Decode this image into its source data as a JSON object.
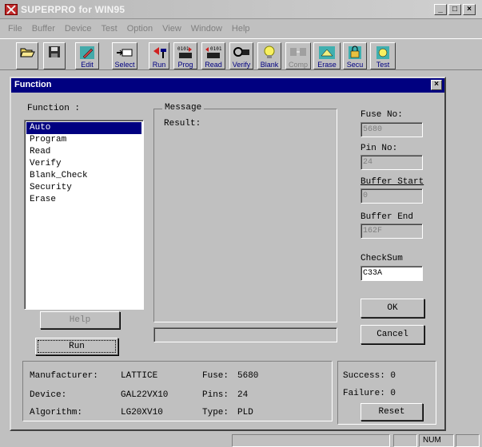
{
  "app": {
    "title": "SUPERPRO for WIN95",
    "min": "_",
    "max": "□",
    "close": "×"
  },
  "menu": [
    "File",
    "Buffer",
    "Device",
    "Test",
    "Option",
    "View",
    "Window",
    "Help"
  ],
  "toolbar": {
    "edit": "Edit",
    "select": "Select",
    "run": "Run",
    "prog": "Prog",
    "read": "Read",
    "verify": "Verify",
    "blank": "Blank",
    "comp": "Comp",
    "erase": "Erase",
    "secu": "Secu",
    "test": "Test"
  },
  "dialog": {
    "title": "Function",
    "close": "×",
    "function_label": "Function :",
    "functions": [
      "Auto",
      "Program",
      "Read",
      "Verify",
      "Blank_Check",
      "Security",
      "Erase"
    ],
    "selected_function": "Auto",
    "message_label": "Message",
    "result_label": "Result:",
    "fuse_no_label": "Fuse No:",
    "fuse_no_value": "5680",
    "pin_no_label": "Pin No:",
    "pin_no_value": "24",
    "buffer_start_label": "Buffer Start",
    "buffer_start_value": "0",
    "buffer_end_label": "Buffer End",
    "buffer_end_value": "162F",
    "checksum_label": "CheckSum",
    "checksum_value": "C33A",
    "ok_label": "OK",
    "cancel_label": "Cancel",
    "help_label": "Help",
    "run_label": "Run",
    "info": {
      "manufacturer_label": "Manufacturer:",
      "manufacturer_value": "LATTICE",
      "device_label": "Device:",
      "device_value": "GAL22VX10",
      "algorithm_label": "Algorithm:",
      "algorithm_value": "LG20XV10",
      "fuse_label": "Fuse:",
      "fuse_value": "5680",
      "pins_label": "Pins:",
      "pins_value": "24",
      "type_label": "Type:",
      "type_value": "PLD"
    },
    "success_label": "Success: 0",
    "failure_label": "Failure: 0",
    "reset_label": "Reset"
  },
  "statusbar": {
    "num": "NUM"
  }
}
